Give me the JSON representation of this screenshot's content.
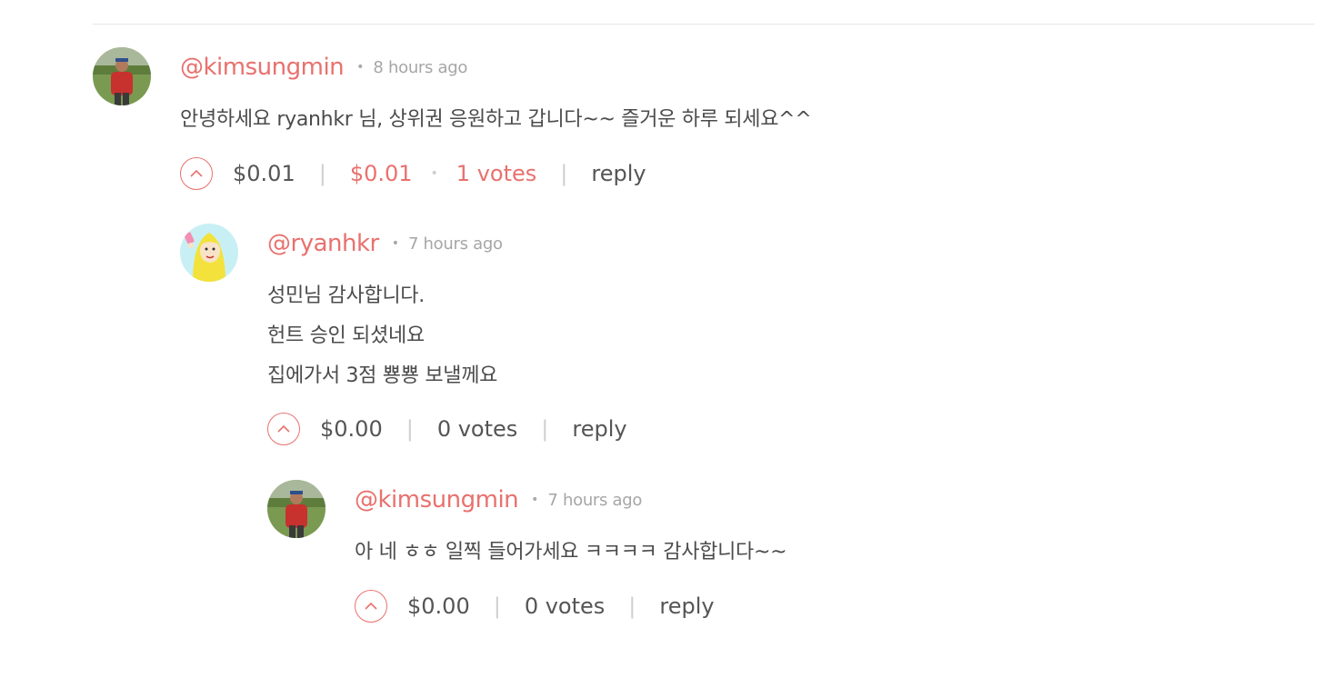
{
  "comments": [
    {
      "author": "@kimsungmin",
      "time": "8 hours ago",
      "body_lines": [
        "안녕하세요 ryanhkr 님, 상위권 응원하고 갑니다~~ 즐거운 하루 되세요^^"
      ],
      "payout": "$0.01",
      "pending": "$0.01",
      "votes": "1 votes",
      "reply": "reply",
      "avatar": "photo-avatar"
    },
    {
      "author": "@ryanhkr",
      "time": "7 hours ago",
      "body_lines": [
        "성민님 감사합니다.",
        "헌트 승인 되셨네요",
        "집에가서 3점 뿅뿅 보낼께요"
      ],
      "payout": "$0.00",
      "votes": "0 votes",
      "reply": "reply",
      "avatar": "cartoon-avatar"
    },
    {
      "author": "@kimsungmin",
      "time": "7 hours ago",
      "body_lines": [
        "아 네 ㅎㅎ 일찍 들어가세요 ㅋㅋㅋㅋ 감사합니다~~"
      ],
      "payout": "$0.00",
      "votes": "0 votes",
      "reply": "reply",
      "avatar": "photo-avatar"
    }
  ],
  "colors": {
    "accent": "#e8716e",
    "text": "#4b4b4b",
    "muted": "#a6a6a6",
    "separator": "#cfcfcf"
  },
  "icons": {
    "upvote": "chevron-up-icon"
  }
}
